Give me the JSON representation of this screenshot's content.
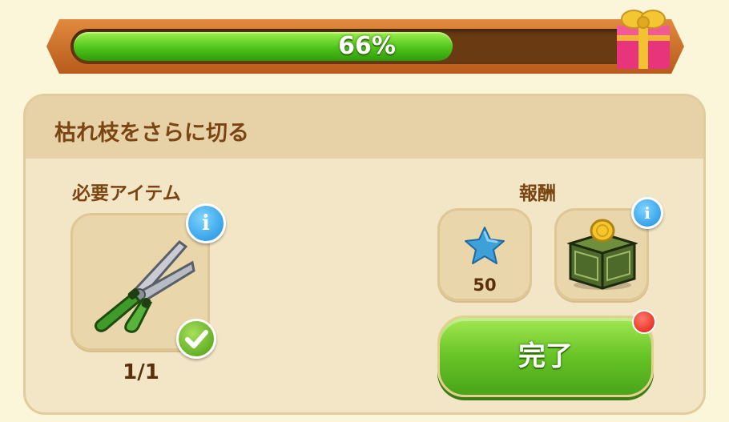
{
  "progress": {
    "value_percent": 66,
    "label": "66%"
  },
  "task": {
    "title": "枯れ枝をさらに切る"
  },
  "required": {
    "heading": "必要アイテム",
    "item_icon": "pruning-shears-icon",
    "count_label": "1/1",
    "info_glyph": "i"
  },
  "reward": {
    "heading": "報酬",
    "items": [
      {
        "icon": "blue-star-icon",
        "amount_label": "50"
      },
      {
        "icon": "coin-crate-icon",
        "info_glyph": "i"
      }
    ]
  },
  "complete_button": {
    "label": "完了"
  },
  "colors": {
    "progress_fill": "#4fc41a",
    "frame": "#b85a1c",
    "button_green": "#67c326",
    "info_blue": "#1a8fe0",
    "notification_red": "#e01b10"
  }
}
